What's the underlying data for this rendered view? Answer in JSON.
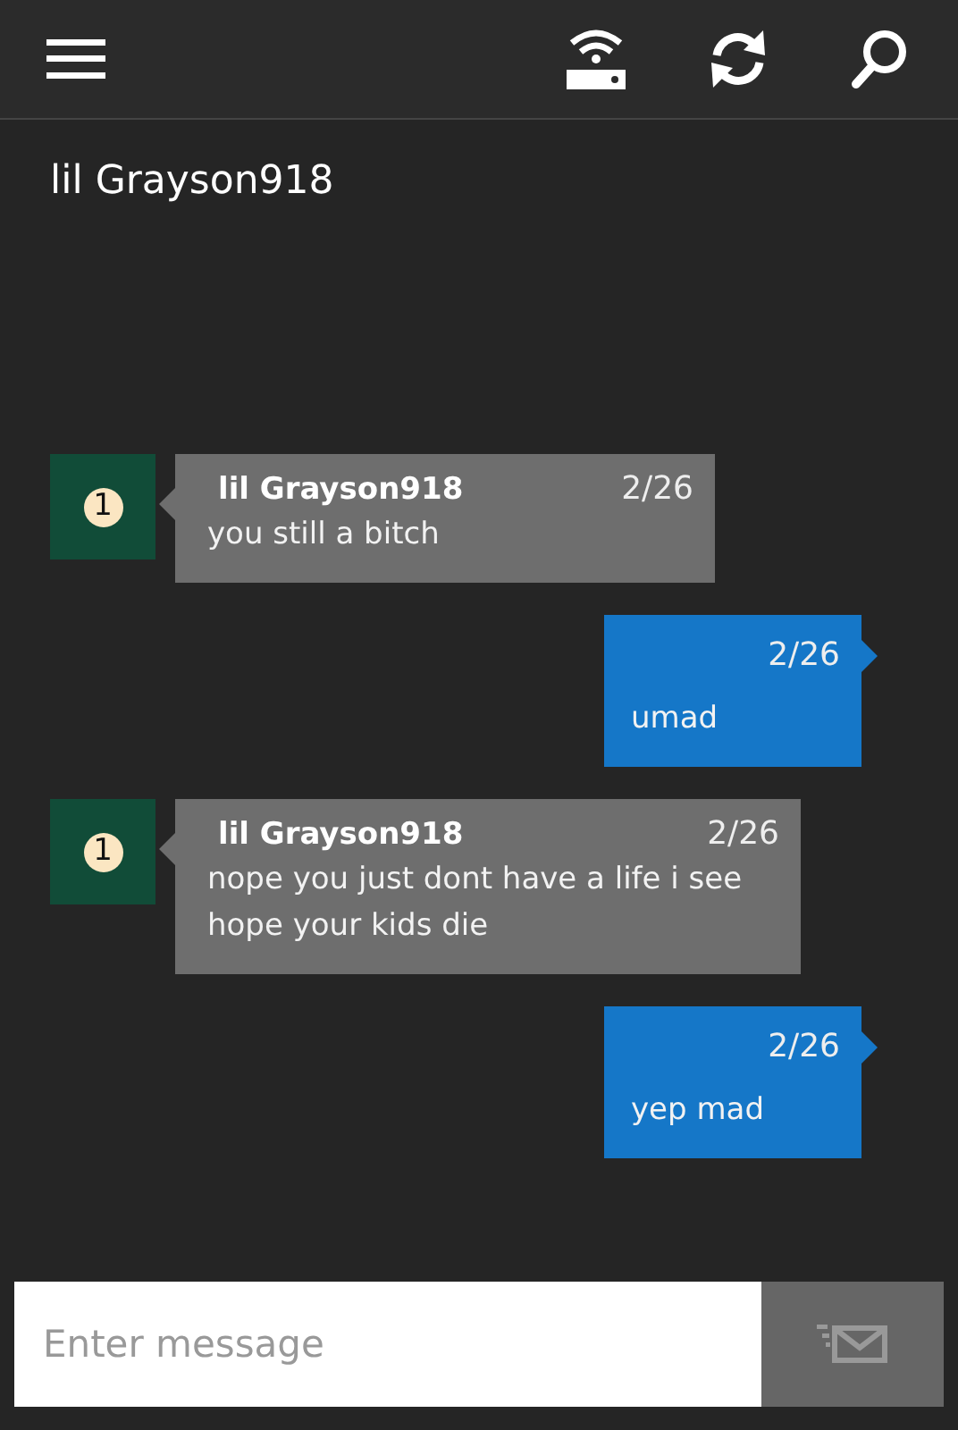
{
  "conversation": {
    "title": "lil Grayson918"
  },
  "messages": [
    {
      "kind": "incoming",
      "avatar": "1",
      "sender": "lil Grayson918",
      "date": "2/26",
      "text": "you still a bitch"
    },
    {
      "kind": "outgoing",
      "date": "2/26",
      "text": "umad"
    },
    {
      "kind": "incoming",
      "avatar": "1",
      "sender": "lil Grayson918",
      "date": "2/26",
      "text": "nope you just dont have a life i see hope your kids die"
    },
    {
      "kind": "outgoing",
      "date": "2/26",
      "text": "yep mad"
    }
  ],
  "composer": {
    "placeholder": "Enter message"
  }
}
